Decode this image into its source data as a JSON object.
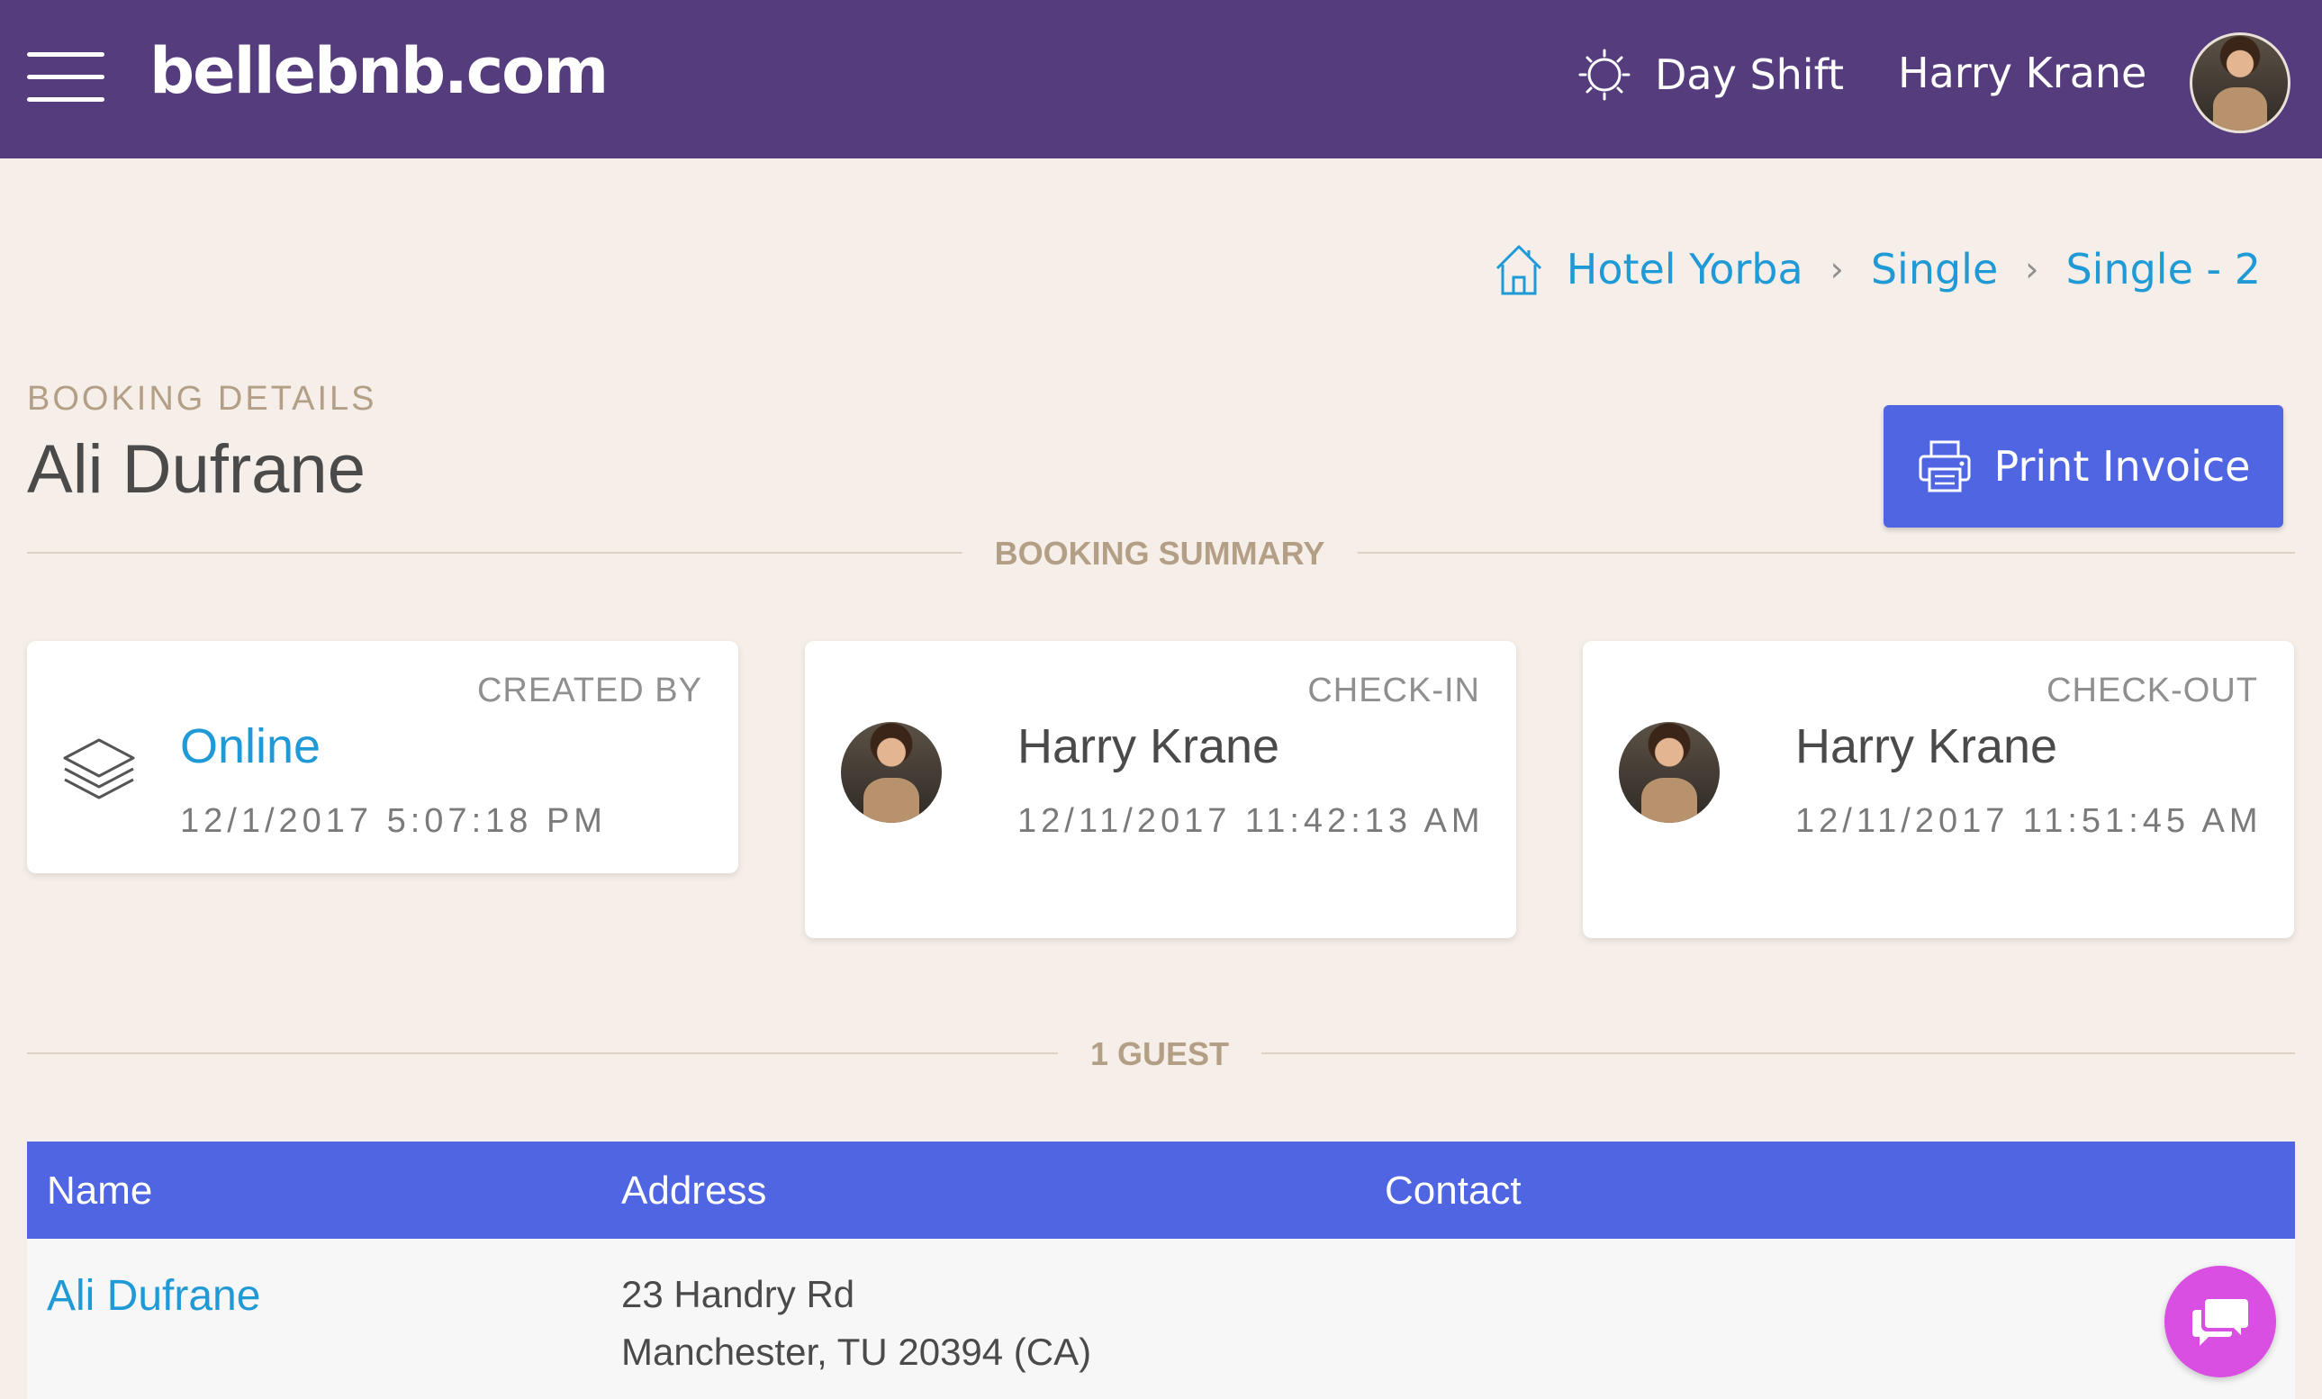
{
  "header": {
    "logo": "bellebnb.com",
    "shift_label": "Day Shift",
    "user_name": "Harry Krane"
  },
  "breadcrumb": {
    "items": [
      "Hotel Yorba",
      "Single",
      "Single - 2"
    ],
    "separator": "›"
  },
  "booking": {
    "kicker": "BOOKING DETAILS",
    "guest_name": "Ali Dufrane",
    "print_label": "Print Invoice"
  },
  "summary": {
    "title": "BOOKING SUMMARY",
    "created": {
      "label": "CREATED BY",
      "value": "Online",
      "time": "12/1/2017 5:07:18 PM"
    },
    "checkin": {
      "label": "CHECK-IN",
      "name": "Harry Krane",
      "time": "12/11/2017 11:42:13 AM"
    },
    "checkout": {
      "label": "CHECK-OUT",
      "name": "Harry Krane",
      "time": "12/11/2017 11:51:45 AM"
    }
  },
  "guests": {
    "title": "1 GUEST",
    "columns": [
      "Name",
      "Address",
      "Contact"
    ],
    "rows": [
      {
        "name": "Ali Dufrane",
        "address_line1": "23 Handry Rd",
        "address_line2": "Manchester, TU 20394 (CA)",
        "contact": ""
      }
    ]
  },
  "colors": {
    "header_bg": "#543c7d",
    "page_bg": "#f6eee8",
    "accent_blue": "#5065e2",
    "link_blue": "#1f9ad6",
    "muted_tan": "#b39f86",
    "chat_fab": "#d94fe1"
  },
  "icons": {
    "menu": "hamburger-menu-icon",
    "shift": "sun-icon",
    "breadcrumb_home": "home-icon",
    "print": "printer-icon",
    "created": "layers-icon",
    "chat": "chat-bubbles-icon"
  }
}
